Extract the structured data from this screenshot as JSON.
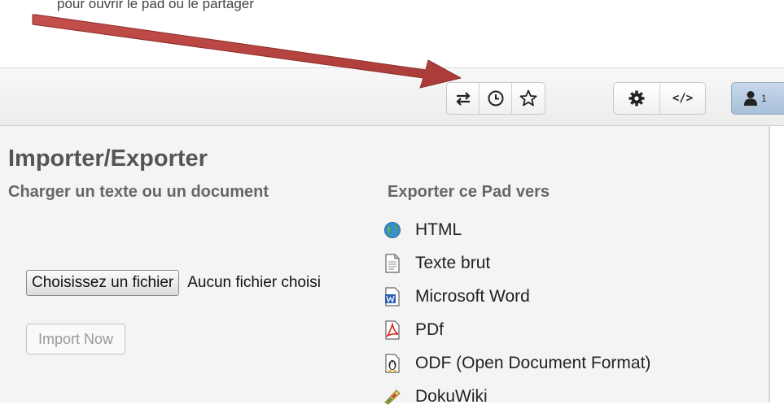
{
  "top_caption": "pour ouvrir le pad ou le partager",
  "toolbar": {
    "import_export_icon": "swap-arrows-icon",
    "history_icon": "clock-icon",
    "star_icon": "star-icon",
    "settings_icon": "gear-icon",
    "embed_label": "</>",
    "user_count": "1"
  },
  "panel": {
    "title": "Importer/Exporter",
    "import": {
      "title": "Charger un texte ou un document",
      "choose_file_label": "Choisissez un fichier",
      "file_status": "Aucun fichier choisi",
      "import_button_label": "Import Now"
    },
    "export": {
      "title": "Exporter ce Pad vers",
      "items": [
        {
          "label": "HTML",
          "icon": "html-globe-icon"
        },
        {
          "label": "Texte brut",
          "icon": "text-file-icon"
        },
        {
          "label": "Microsoft Word",
          "icon": "word-icon"
        },
        {
          "label": "PDf",
          "icon": "pdf-icon"
        },
        {
          "label": "ODF (Open Document Format)",
          "icon": "odf-icon"
        },
        {
          "label": "DokuWiki",
          "icon": "dokuwiki-icon"
        }
      ]
    }
  },
  "colors": {
    "annotation_arrow": "#c0504d",
    "user_button": "#b4cae2",
    "panel_bg": "#f4f4f4"
  }
}
